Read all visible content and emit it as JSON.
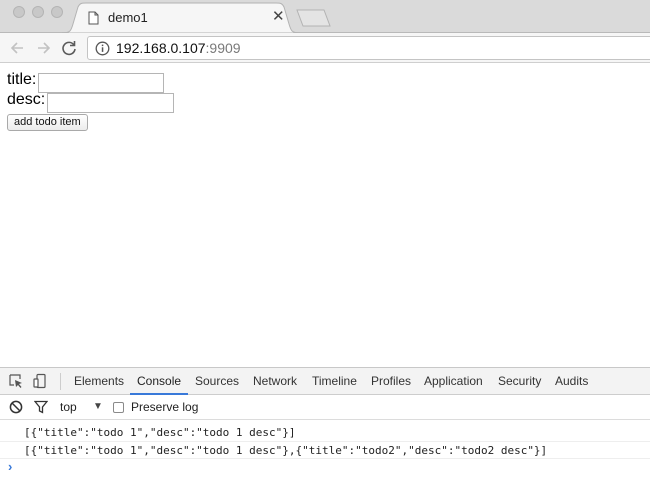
{
  "browser": {
    "tab": {
      "title": "demo1",
      "close_glyph": "✕"
    },
    "address": {
      "host": "192.168.0.107",
      "port": ":9909"
    }
  },
  "form": {
    "title_label": "title:",
    "title_value": "",
    "desc_label": "desc:",
    "desc_value": "",
    "add_button": "add todo item"
  },
  "devtools": {
    "tabs": [
      {
        "label": "Elements"
      },
      {
        "label": "Console",
        "active": true
      },
      {
        "label": "Sources"
      },
      {
        "label": "Network"
      },
      {
        "label": "Timeline"
      },
      {
        "label": "Profiles"
      },
      {
        "label": "Application"
      },
      {
        "label": "Security"
      },
      {
        "label": "Audits"
      }
    ],
    "context": "top",
    "context_arrow": "▼",
    "preserve_log": {
      "label": "Preserve log",
      "checked": false
    },
    "logs": [
      "[{\"title\":\"todo 1\",\"desc\":\"todo 1 desc\"}]",
      "[{\"title\":\"todo 1\",\"desc\":\"todo 1 desc\"},{\"title\":\"todo2\",\"desc\":\"todo2 desc\"}]"
    ],
    "prompt_glyph": "›"
  },
  "colors": {
    "accent": "#3879d9",
    "tab_strip": "#dadada",
    "toolbar": "#f6f6f6"
  }
}
